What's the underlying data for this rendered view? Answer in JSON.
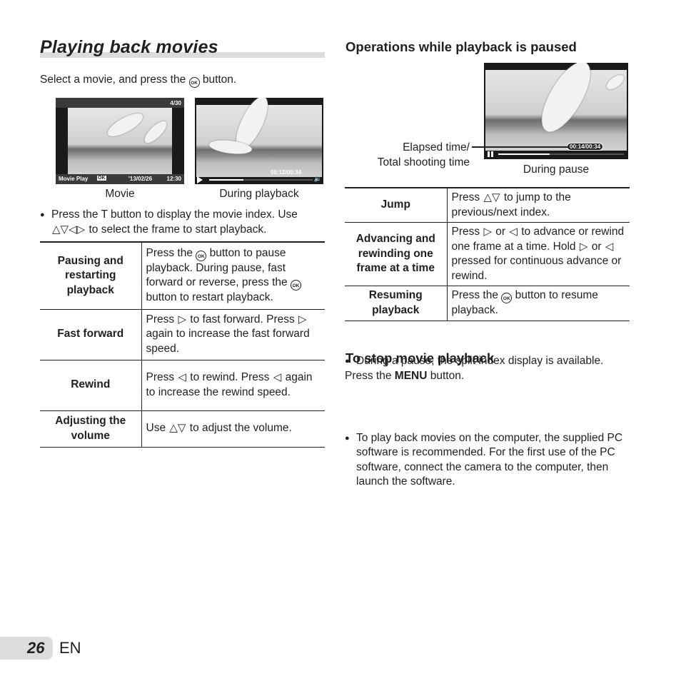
{
  "left": {
    "title": "Playing back movies",
    "intro_before": "Select a movie, and press the",
    "intro_after": "button.",
    "ok_icon": "OK",
    "screen_movie": {
      "counter": "4/30",
      "label": "Movie Play",
      "ok": "OK",
      "date": "'13/02/26",
      "time": "12:30",
      "caption": "Movie"
    },
    "screen_playback": {
      "elapsed": "00:12/00:34",
      "progress": 0.33,
      "caption": "During playback"
    },
    "bullet_line1": "Press the T button to display the movie index. Use",
    "bullet_line2": "to select the frame to start playback.",
    "arrows": "△▽◁▷",
    "table": [
      {
        "key": "Pausing and restarting playback",
        "value_parts": [
          "Press the ",
          "OK",
          " button to pause playback. During pause, fast forward or reverse, press the ",
          "OK",
          " button to restart playback."
        ]
      },
      {
        "key": "Fast forward",
        "value_parts": [
          "Press ",
          "▷",
          " to fast forward. Press ",
          "▷",
          " again to increase the fast forward speed."
        ]
      },
      {
        "key": "Rewind",
        "value_parts": [
          "Press ",
          "◁",
          " to rewind. Press ",
          "◁",
          " again to increase the rewind speed."
        ]
      },
      {
        "key": "Adjusting the volume",
        "value_parts": [
          "Use ",
          "△▽",
          " to adjust the volume."
        ]
      }
    ]
  },
  "right": {
    "heading": "Operations while playback is paused",
    "callout_line1": "Elapsed time/",
    "callout_line2": "Total shooting time",
    "screen_pause": {
      "elapsed": "00:14/00:34",
      "progress": 0.41,
      "caption": "During pause"
    },
    "table": [
      {
        "key": "Jump",
        "value_parts": [
          "Press ",
          "△▽",
          " to jump to the previous/next index."
        ]
      },
      {
        "key": "Advancing and rewinding one frame at a time",
        "value_parts": [
          "Press ",
          "▷",
          " or ",
          "◁",
          " to advance or rewind one frame at a time. Hold ",
          "▷",
          " or ",
          "◁",
          " pressed for continuous advance or rewind."
        ]
      },
      {
        "key": "Resuming playback",
        "value_parts": [
          "Press the ",
          "OK",
          " button to resume playback."
        ]
      }
    ],
    "pause_note": "During a pause, the split index display is available.",
    "stop_heading": "To stop movie playback",
    "stop_before": "Press the",
    "stop_menu": "MENU",
    "stop_after": "button.",
    "pc_note": "To play back movies on the computer, the supplied PC software is recommended. For the first use of the PC software, connect the camera to the computer, then launch the software."
  },
  "footer": {
    "page_number": "26",
    "language": "EN"
  }
}
